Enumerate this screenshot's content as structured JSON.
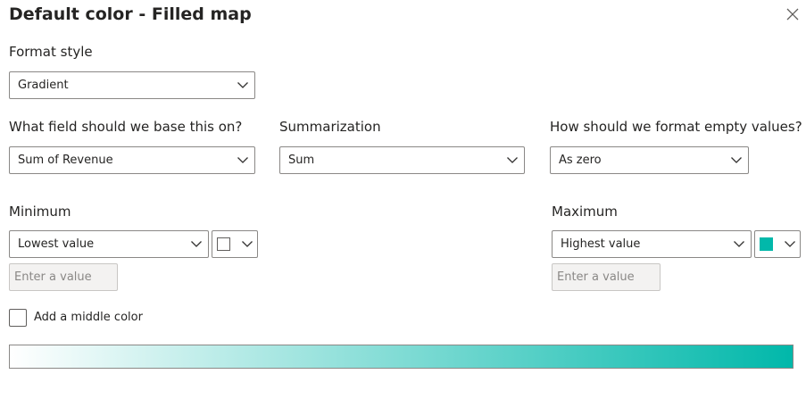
{
  "dialog": {
    "title": "Default color - Filled map",
    "close_icon": "close-icon"
  },
  "format_style": {
    "label": "Format style",
    "value": "Gradient"
  },
  "base_field": {
    "label": "What field should we base this on?",
    "value": "Sum of Revenue"
  },
  "summarization": {
    "label": "Summarization",
    "value": "Sum"
  },
  "empty_values": {
    "label": "How should we format empty values?",
    "value": "As zero"
  },
  "minimum": {
    "label": "Minimum",
    "value": "Lowest value",
    "color": "#ffffff",
    "input_placeholder": "Enter a value"
  },
  "maximum": {
    "label": "Maximum",
    "value": "Highest value",
    "color": "#01b8aa",
    "input_placeholder": "Enter a value"
  },
  "middle_color": {
    "label": "Add a middle color",
    "checked": false
  },
  "gradient_preview": {
    "start_color": "#ffffff",
    "end_color": "#01b8aa"
  }
}
